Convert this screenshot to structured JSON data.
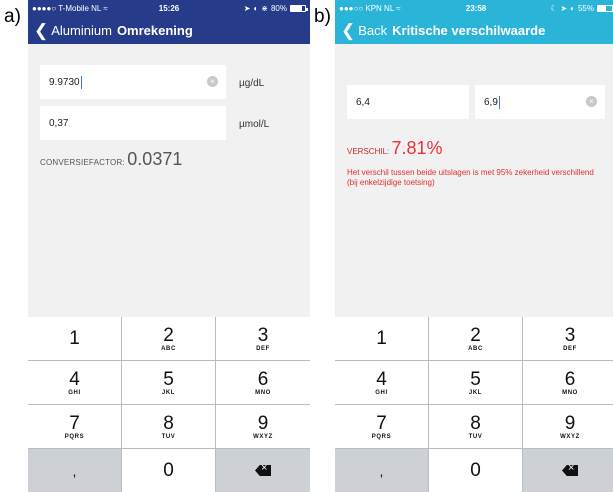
{
  "panels": [
    {
      "label": "a)",
      "status": {
        "left": "●●●●○ T-Mobile NL",
        "time": "15:26",
        "battery": "80%",
        "battery_level": 0.8
      },
      "nav": {
        "back_label": "Aluminium",
        "title": "Omrekening"
      },
      "fields": [
        {
          "value": "9.9730",
          "unit": "µg/dL"
        },
        {
          "value": "0,37",
          "unit": "µmol/L"
        }
      ],
      "factor": {
        "label": "CONVERSIEFACTOR:",
        "value": "0.0371"
      }
    },
    {
      "label": "b)",
      "status": {
        "left": "●●●○○ KPN NL",
        "time": "23:58",
        "battery": "55%",
        "battery_level": 0.55
      },
      "nav": {
        "back_label": "Back",
        "title": "Kritische verschilwaarde"
      },
      "fields": [
        {
          "value": "6,4"
        },
        {
          "value": "6,9"
        }
      ],
      "result": {
        "label": "VERSCHIL:",
        "value": "7.81%",
        "message": "Het verschil tussen beide uitslagen is met 95% zekerheid verschillend (bij enkelzijdige toetsing)"
      }
    }
  ],
  "keyboard": {
    "keys": [
      {
        "num": "1",
        "letters": ""
      },
      {
        "num": "2",
        "letters": "ABC"
      },
      {
        "num": "3",
        "letters": "DEF"
      },
      {
        "num": "4",
        "letters": "GHI"
      },
      {
        "num": "5",
        "letters": "JKL"
      },
      {
        "num": "6",
        "letters": "MNO"
      },
      {
        "num": "7",
        "letters": "PQRS"
      },
      {
        "num": "8",
        "letters": "TUV"
      },
      {
        "num": "9",
        "letters": "WXYZ"
      }
    ],
    "comma": ",",
    "zero": "0",
    "delete_icon": "backspace-icon"
  }
}
